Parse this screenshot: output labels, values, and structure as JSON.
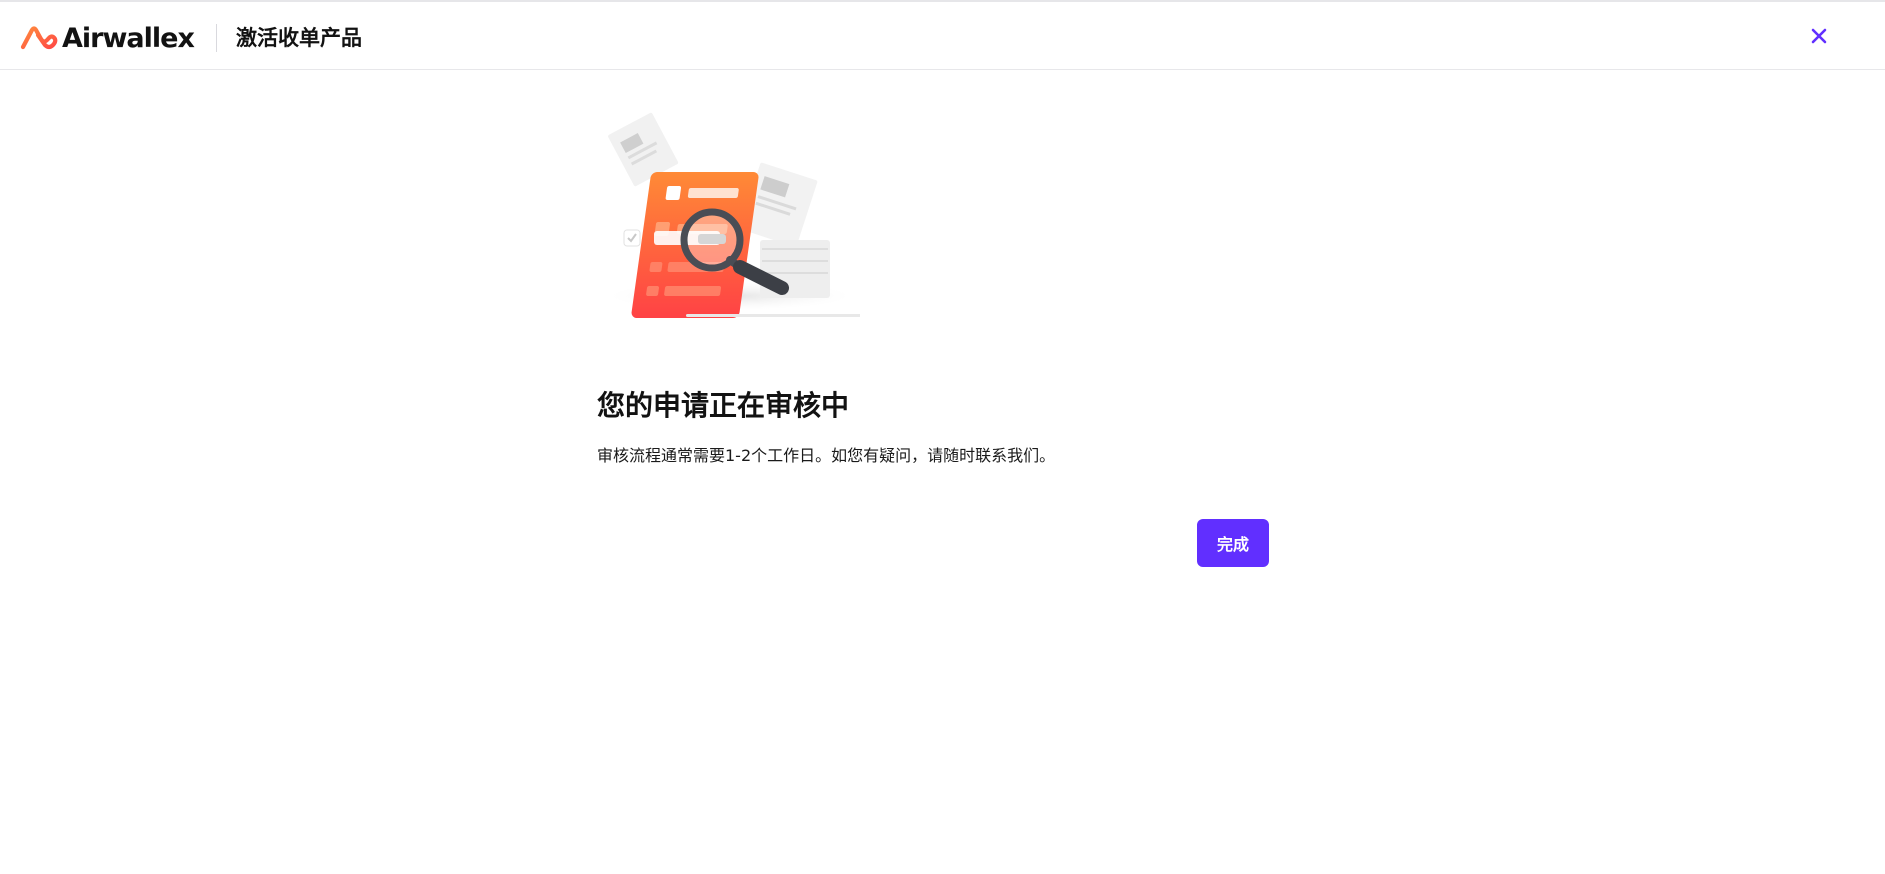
{
  "header": {
    "brand_name": "Airwallex",
    "page_title": "激活收单产品",
    "close_icon": "close-icon"
  },
  "main": {
    "illustration": "review-document-magnifier-illustration",
    "title": "您的申请正在审核中",
    "description": "审核流程通常需要1-2个工作日。如您有疑问，请随时联系我们。",
    "done_label": "完成"
  },
  "colors": {
    "brand_orange": "#ff6a3d",
    "accent_purple": "#612fff",
    "text_dark": "#121212"
  }
}
